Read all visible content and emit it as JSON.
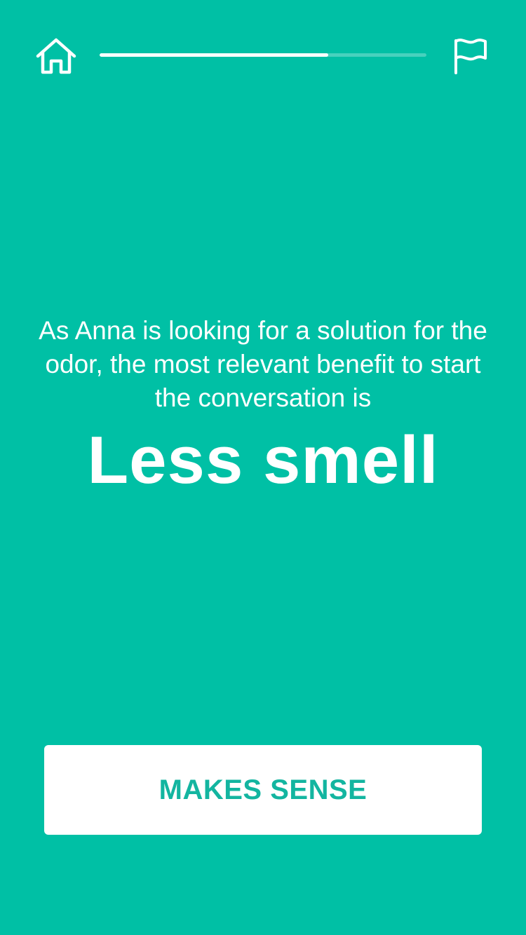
{
  "header": {
    "home_icon": "home-icon",
    "flag_icon": "flag-icon",
    "progress": 0.7
  },
  "message": {
    "lead": "As Anna is looking for a solution for the odor, the most relevant benefit to start the conversation is",
    "headline": "Less smell"
  },
  "cta": {
    "label": "MAKES SENSE"
  },
  "colors": {
    "background": "#00C0A5",
    "button_text": "#13B5A0",
    "foreground": "#FFFFFF"
  }
}
